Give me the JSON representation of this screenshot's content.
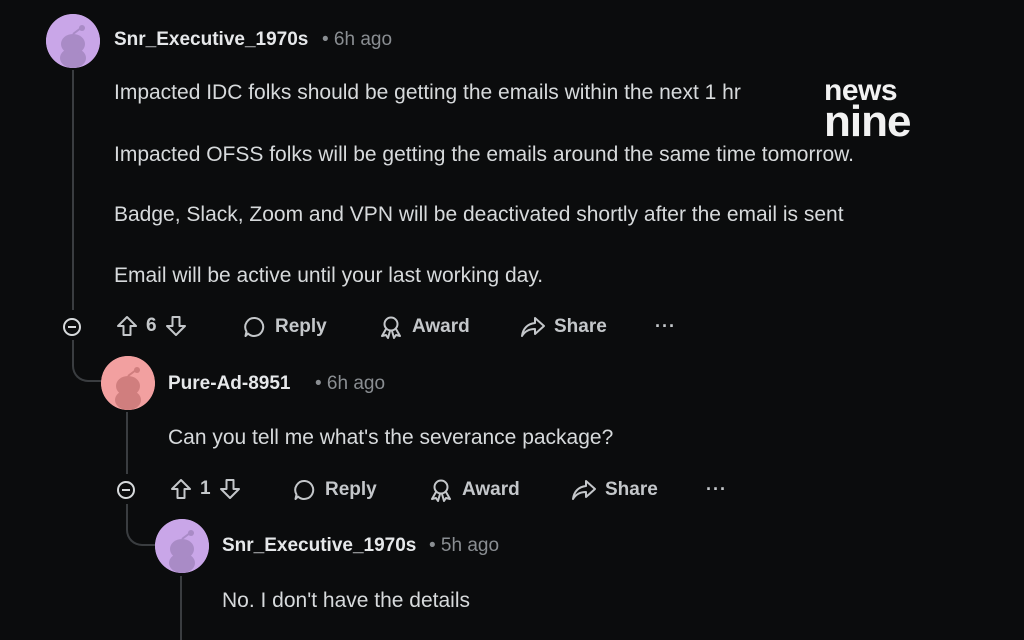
{
  "comments": [
    {
      "username": "Snr_Executive_1970s",
      "time": "• 6h ago",
      "avatar_color": "#c9a6e8",
      "lines": [
        "Impacted IDC folks should be getting the emails within the next 1 hr",
        "Impacted OFSS folks will be getting the emails around the same time tomorrow.",
        "Badge, Slack, Zoom and VPN will be deactivated shortly after the email is sent",
        "Email will be active until your last working day."
      ],
      "votes": "6",
      "reply_label": "Reply",
      "award_label": "Award",
      "share_label": "Share",
      "more_label": "···"
    },
    {
      "username": "Pure-Ad-8951",
      "time": "• 6h ago",
      "avatar_color": "#f2a0a0",
      "lines": [
        "Can you tell me what's the severance package?"
      ],
      "votes": "1",
      "reply_label": "Reply",
      "award_label": "Award",
      "share_label": "Share",
      "more_label": "···"
    },
    {
      "username": "Snr_Executive_1970s",
      "time": "• 5h ago",
      "avatar_color": "#c9a6e8",
      "lines": [
        "No. I don't have the details"
      ]
    }
  ],
  "watermark": {
    "top": "news",
    "bottom": "nine"
  }
}
